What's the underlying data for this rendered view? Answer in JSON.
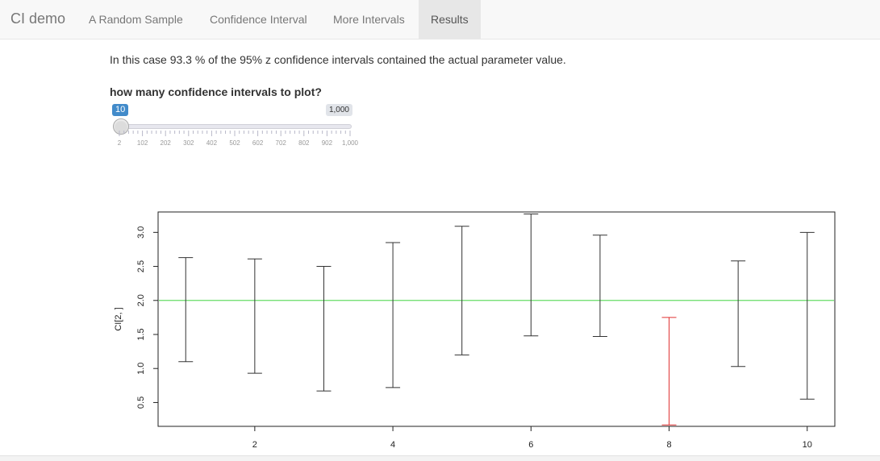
{
  "nav": {
    "brand": "CI demo",
    "tabs": [
      {
        "label": "A Random Sample",
        "active": false
      },
      {
        "label": "Confidence Interval",
        "active": false
      },
      {
        "label": "More Intervals",
        "active": false
      },
      {
        "label": "Results",
        "active": true
      }
    ]
  },
  "main": {
    "summary": "In this case 93.3 % of the 95% z confidence intervals contained the actual parameter value."
  },
  "slider": {
    "label": "how many confidence intervals to plot?",
    "value": "10",
    "max_label": "1,000",
    "min": 2,
    "max": 1000,
    "current": 10,
    "tick_labels": [
      "2",
      "102",
      "202",
      "302",
      "402",
      "502",
      "602",
      "702",
      "802",
      "902",
      "1,000"
    ]
  },
  "chart_data": {
    "type": "error-bar",
    "ylabel": "CI[2, ]",
    "xlabel": "",
    "x_ticks": [
      "2",
      "4",
      "6",
      "8",
      "10"
    ],
    "y_ticks": [
      "0.5",
      "1.0",
      "1.5",
      "2.0",
      "2.5",
      "3.0"
    ],
    "xlim": [
      0.6,
      10.4
    ],
    "ylim": [
      0.15,
      3.3
    ],
    "reference_line": {
      "y": 2.0,
      "color": "#66dd66"
    },
    "intervals": [
      {
        "x": 1,
        "lower": 1.1,
        "upper": 2.63,
        "color": "#333333"
      },
      {
        "x": 2,
        "lower": 0.93,
        "upper": 2.61,
        "color": "#333333"
      },
      {
        "x": 3,
        "lower": 0.67,
        "upper": 2.5,
        "color": "#333333"
      },
      {
        "x": 4,
        "lower": 0.72,
        "upper": 2.85,
        "color": "#333333"
      },
      {
        "x": 5,
        "lower": 1.2,
        "upper": 3.09,
        "color": "#333333"
      },
      {
        "x": 6,
        "lower": 1.48,
        "upper": 3.27,
        "color": "#333333"
      },
      {
        "x": 7,
        "lower": 1.47,
        "upper": 2.96,
        "color": "#333333"
      },
      {
        "x": 8,
        "lower": 0.17,
        "upper": 1.75,
        "color": "#e03030"
      },
      {
        "x": 9,
        "lower": 1.03,
        "upper": 2.58,
        "color": "#333333"
      },
      {
        "x": 10,
        "lower": 0.55,
        "upper": 3.0,
        "color": "#333333"
      }
    ]
  }
}
